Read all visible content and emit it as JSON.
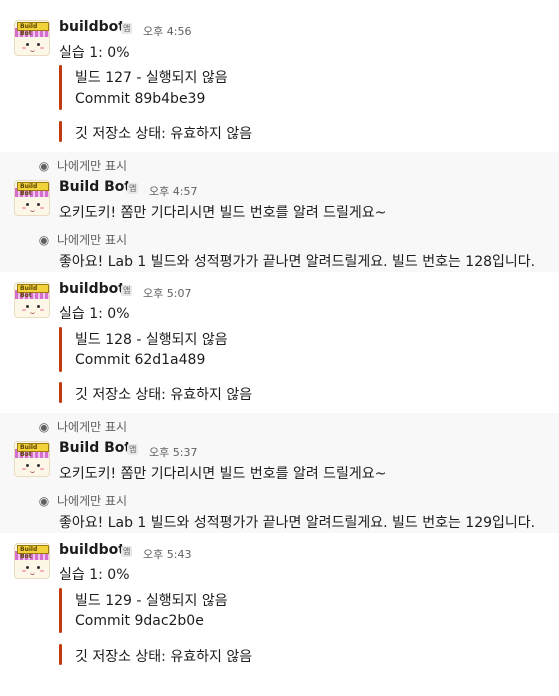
{
  "labels": {
    "app_badge": "앱",
    "only_visible_to_you": "나에게만 표시"
  },
  "icons": {
    "eye": "eye-icon",
    "avatar": "buildbot-avatar"
  },
  "colors": {
    "accent_bar": "#c13a10",
    "ephemeral_bg": "#f8f8f8"
  },
  "avatar_tag": "Build Bot",
  "messages": [
    {
      "sender": "buildbot",
      "time": "오후 4:56",
      "text": "실습 1: 0%",
      "attachment": {
        "line1": "빌드 127 - 실행되지 않음",
        "line2": "Commit 89b4be39"
      },
      "status": "깃 저장소 상태: 유효하지 않음"
    },
    {
      "sender": "Build Bot",
      "time": "오후 4:57",
      "text": "오키도키! 쫌만 기다리시면 빌드 번호를 알려 드릴게요~",
      "followup": "좋아요! Lab 1 빌드와 성적평가가 끝나면 알려드릴게요. 빌드 번호는 128입니다."
    },
    {
      "sender": "buildbot",
      "time": "오후 5:07",
      "text": "실습 1: 0%",
      "attachment": {
        "line1": "빌드 128 - 실행되지 않음",
        "line2": "Commit 62d1a489"
      },
      "status": "깃 저장소 상태: 유효하지 않음"
    },
    {
      "sender": "Build Bot",
      "time": "오후 5:37",
      "text": "오키도키! 쫌만 기다리시면 빌드 번호를 알려 드릴게요~",
      "followup": "좋아요! Lab 1 빌드와 성적평가가 끝나면 알려드릴게요. 빌드 번호는 129입니다."
    },
    {
      "sender": "buildbot",
      "time": "오후 5:43",
      "text": "실습 1: 0%",
      "attachment": {
        "line1": "빌드 129 - 실행되지 않음",
        "line2": "Commit 9dac2b0e"
      },
      "status": "깃 저장소 상태: 유효하지 않음"
    }
  ]
}
